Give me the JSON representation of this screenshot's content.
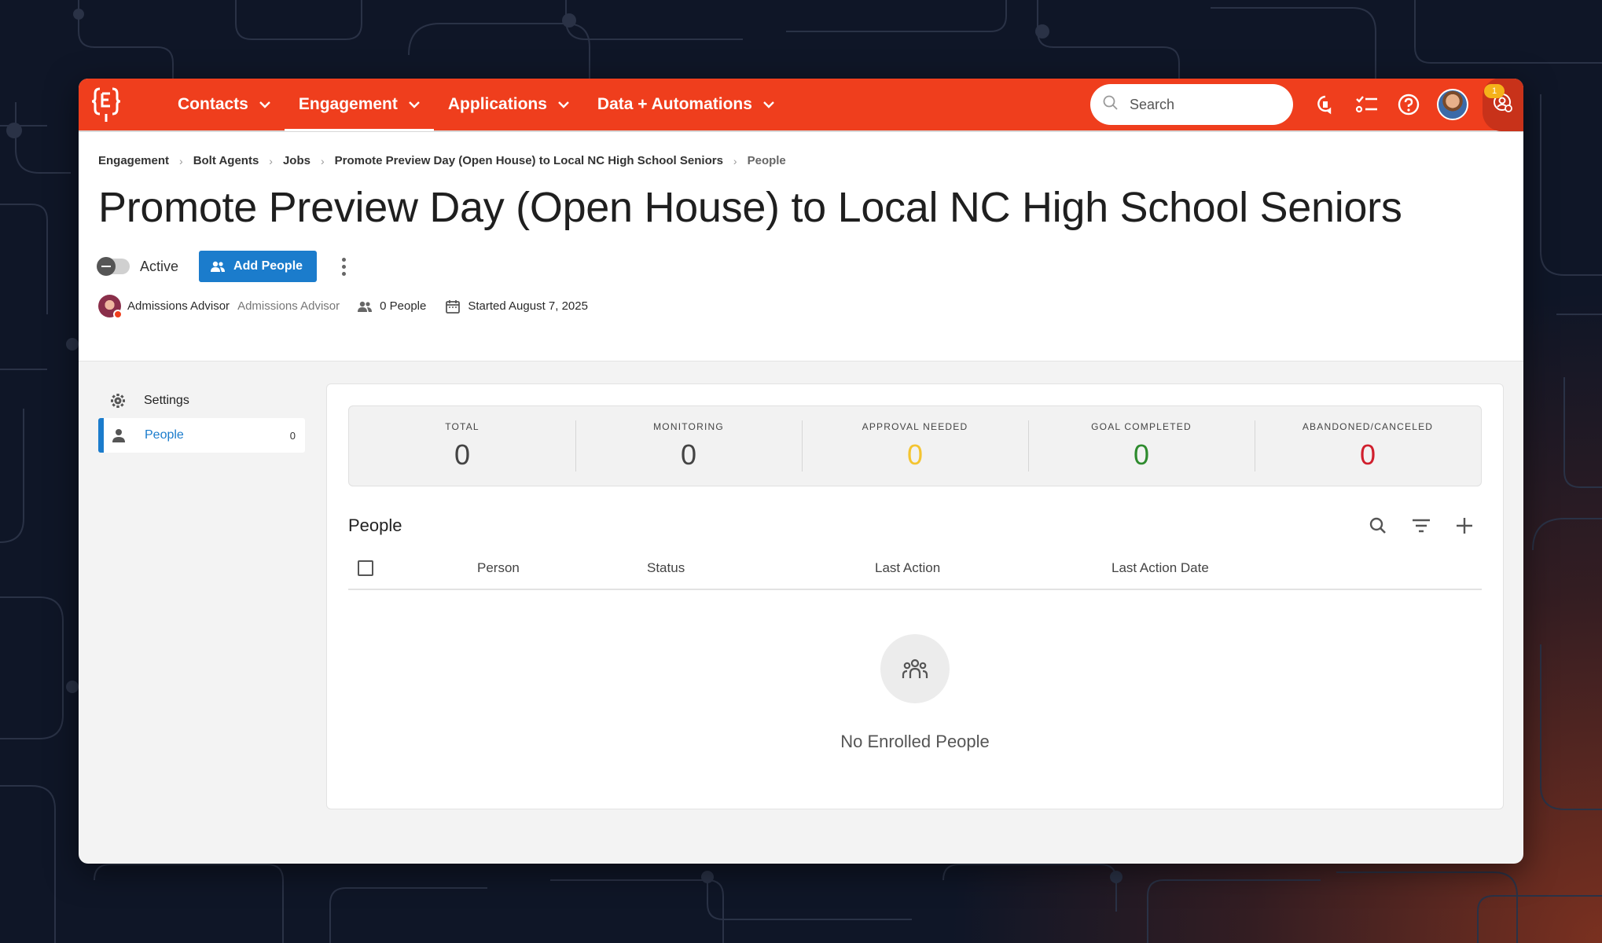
{
  "nav": {
    "items": [
      {
        "label": "Contacts"
      },
      {
        "label": "Engagement"
      },
      {
        "label": "Applications"
      },
      {
        "label": "Data + Automations"
      }
    ],
    "search_placeholder": "Search",
    "notification_count": "1",
    "brand_color": "#ef3e1d"
  },
  "breadcrumb": [
    "Engagement",
    "Bolt Agents",
    "Jobs",
    "Promote Preview Day (Open House) to Local NC High School Seniors",
    "People"
  ],
  "page": {
    "title": "Promote Preview Day (Open House) to Local NC High School Seniors",
    "toggle_label": "Active",
    "add_button": "Add People",
    "owner_name": "Admissions Advisor",
    "owner_role": "Admissions Advisor",
    "people_count": "0 People",
    "started": "Started August 7, 2025"
  },
  "sidebar": {
    "items": [
      {
        "label": "Settings",
        "icon": "gear-icon"
      },
      {
        "label": "People",
        "icon": "person-icon",
        "count": "0"
      }
    ]
  },
  "stats": [
    {
      "label": "TOTAL",
      "value": "0",
      "color": "#444444"
    },
    {
      "label": "MONITORING",
      "value": "0",
      "color": "#444444"
    },
    {
      "label": "APPROVAL NEEDED",
      "value": "0",
      "color": "#f4c430"
    },
    {
      "label": "GOAL COMPLETED",
      "value": "0",
      "color": "#2e8b2e"
    },
    {
      "label": "ABANDONED/CANCELED",
      "value": "0",
      "color": "#d01f2d"
    }
  ],
  "people_table": {
    "title": "People",
    "columns": [
      "Person",
      "Status",
      "Last Action",
      "Last Action Date"
    ],
    "empty_text": "No Enrolled People"
  }
}
